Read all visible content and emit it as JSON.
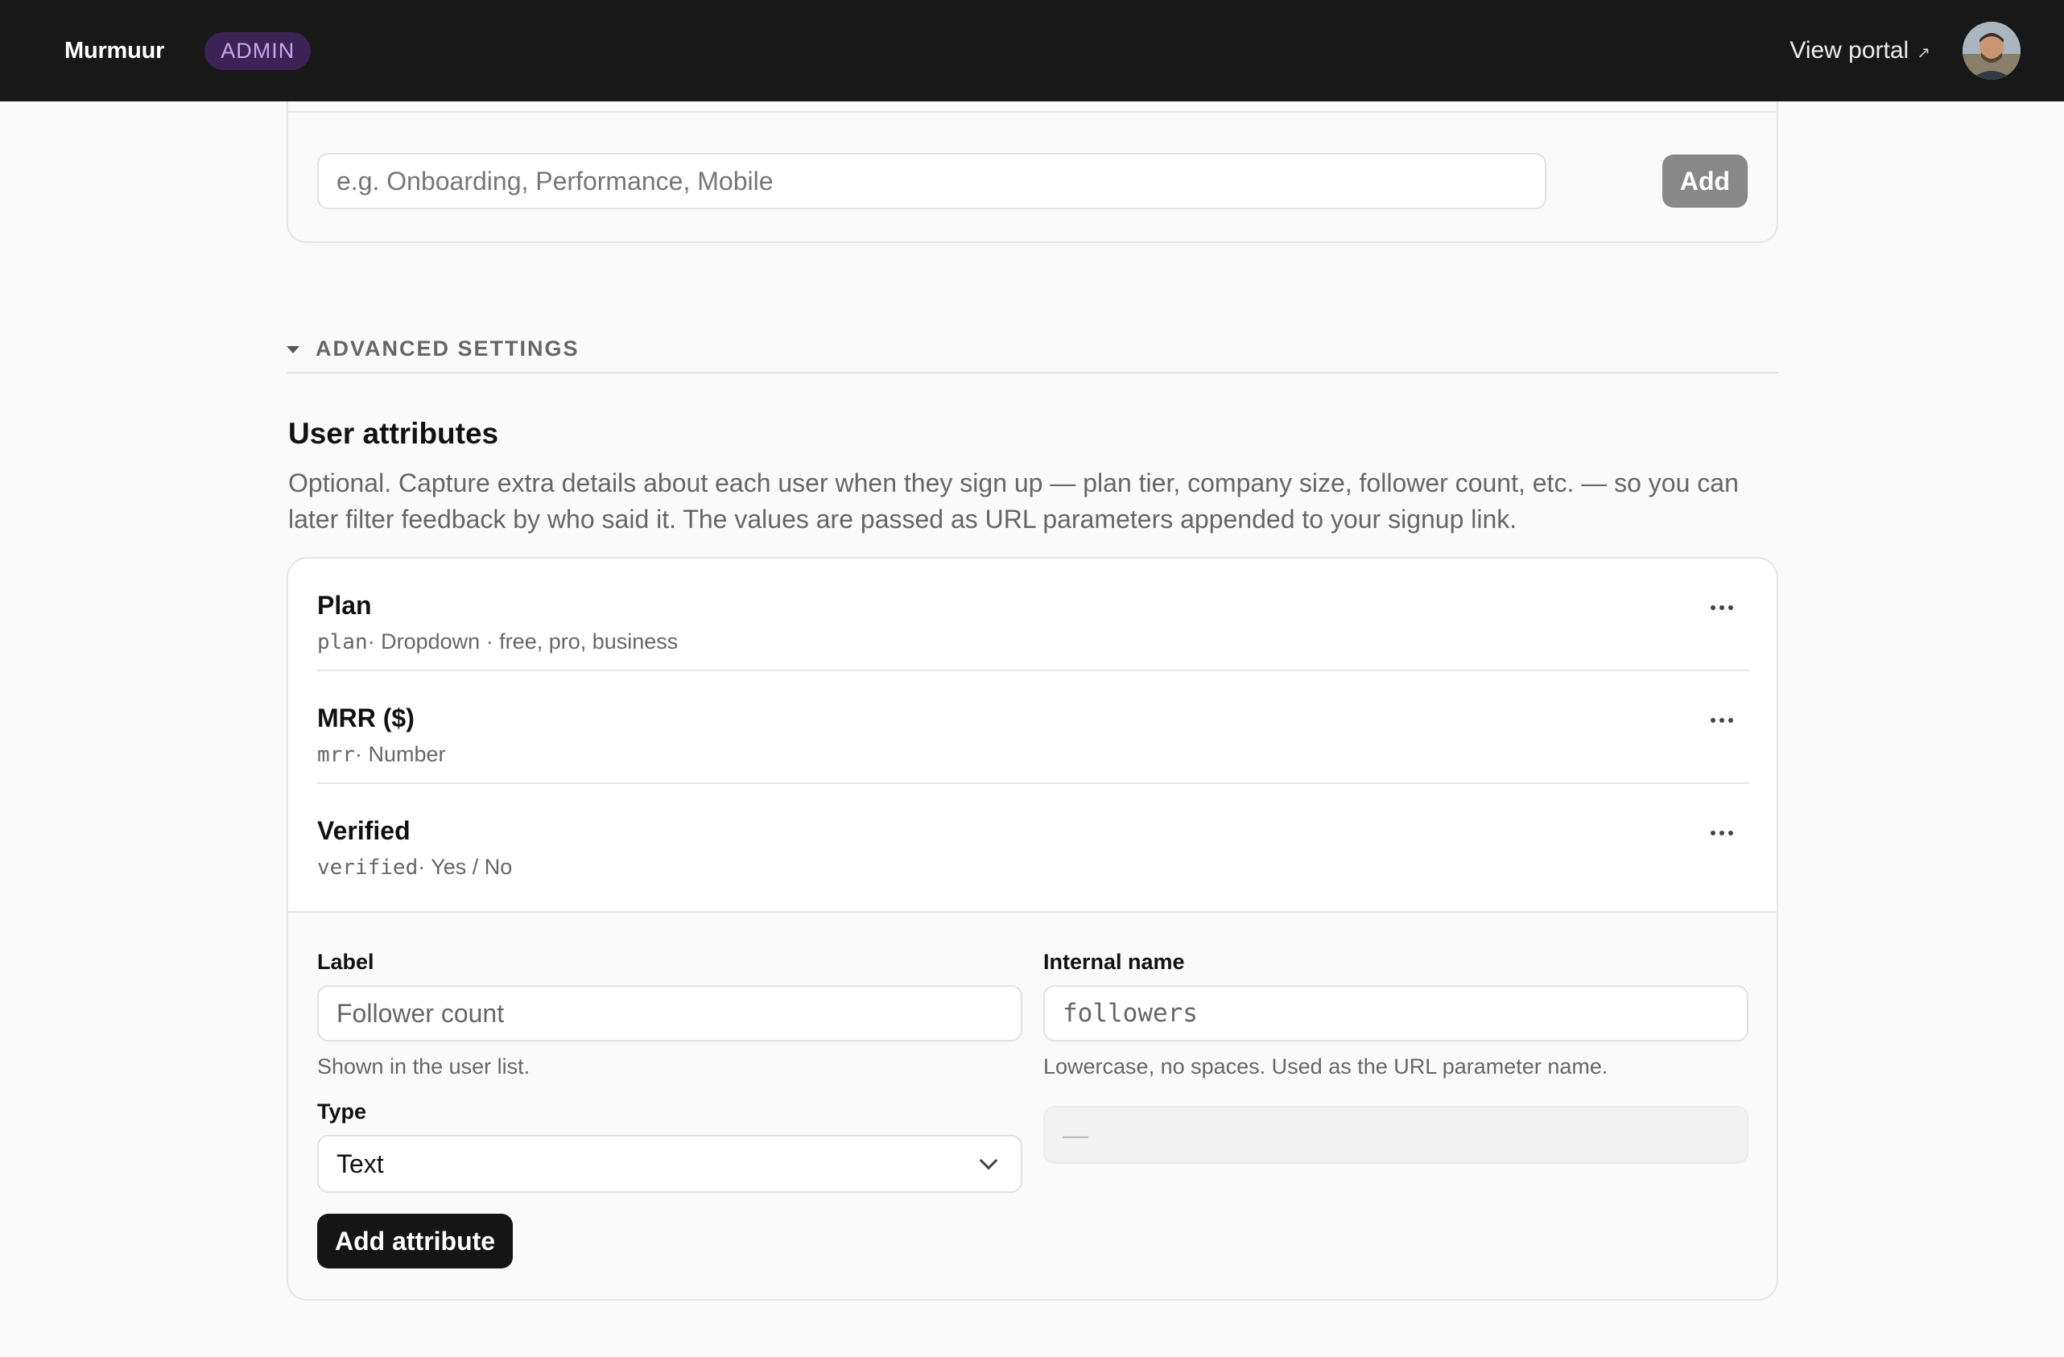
{
  "header": {
    "brand": "Murmuur",
    "badge": "ADMIN",
    "view_portal": "View portal",
    "view_portal_arrow": "↗"
  },
  "tags": {
    "placeholder": "e.g. Onboarding, Performance, Mobile",
    "add_label": "Add"
  },
  "advanced": {
    "label": "ADVANCED SETTINGS"
  },
  "user_attributes": {
    "title": "User attributes",
    "description": "Optional. Capture extra details about each user when they sign up — plan tier, company size, follower count, etc. — so you can later filter feedback by who said it. The values are passed as URL parameters appended to your signup link.",
    "items": [
      {
        "label": "Plan",
        "key": "plan",
        "meta": " · Dropdown · free, pro, business"
      },
      {
        "label": "MRR ($)",
        "key": "mrr",
        "meta": " · Number"
      },
      {
        "label": "Verified",
        "key": "verified",
        "meta": " · Yes / No"
      }
    ],
    "form": {
      "label_title": "Label",
      "label_placeholder": "Follower count",
      "label_hint": "Shown in the user list.",
      "internal_title": "Internal name",
      "internal_placeholder": "followers",
      "internal_hint": "Lowercase, no spaces. Used as the URL parameter name.",
      "type_title": "Type",
      "type_value": "Text",
      "options_value": "—",
      "submit_label": "Add attribute"
    }
  }
}
